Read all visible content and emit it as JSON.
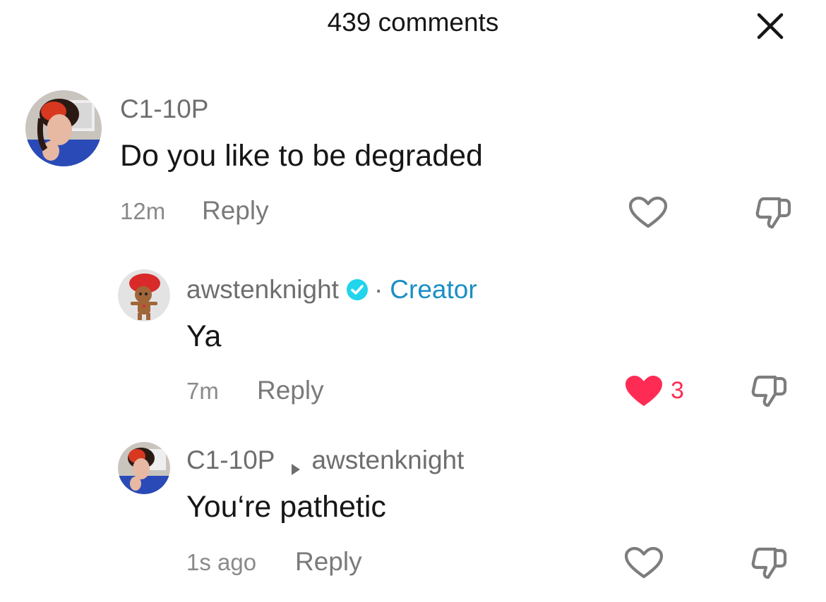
{
  "header": {
    "title": "439 comments",
    "close_icon": "close-icon"
  },
  "comments": [
    {
      "username": "C1-10P",
      "text": "Do you like to be degraded",
      "time": "12m",
      "reply_label": "Reply",
      "liked": false
    },
    {
      "username": "awstenknight",
      "verified": true,
      "separator": "·",
      "badge": "Creator",
      "text": "Ya",
      "time": "7m",
      "reply_label": "Reply",
      "liked": true,
      "like_count": "3"
    },
    {
      "username": "C1-10P",
      "reply_to": "awstenknight",
      "text": "You‘re pathetic",
      "time": "1s ago",
      "reply_label": "Reply",
      "liked": false
    }
  ],
  "colors": {
    "like_red": "#fe2c55",
    "creator_blue": "#1b8ec5",
    "verified_blue": "#20d5ec"
  }
}
